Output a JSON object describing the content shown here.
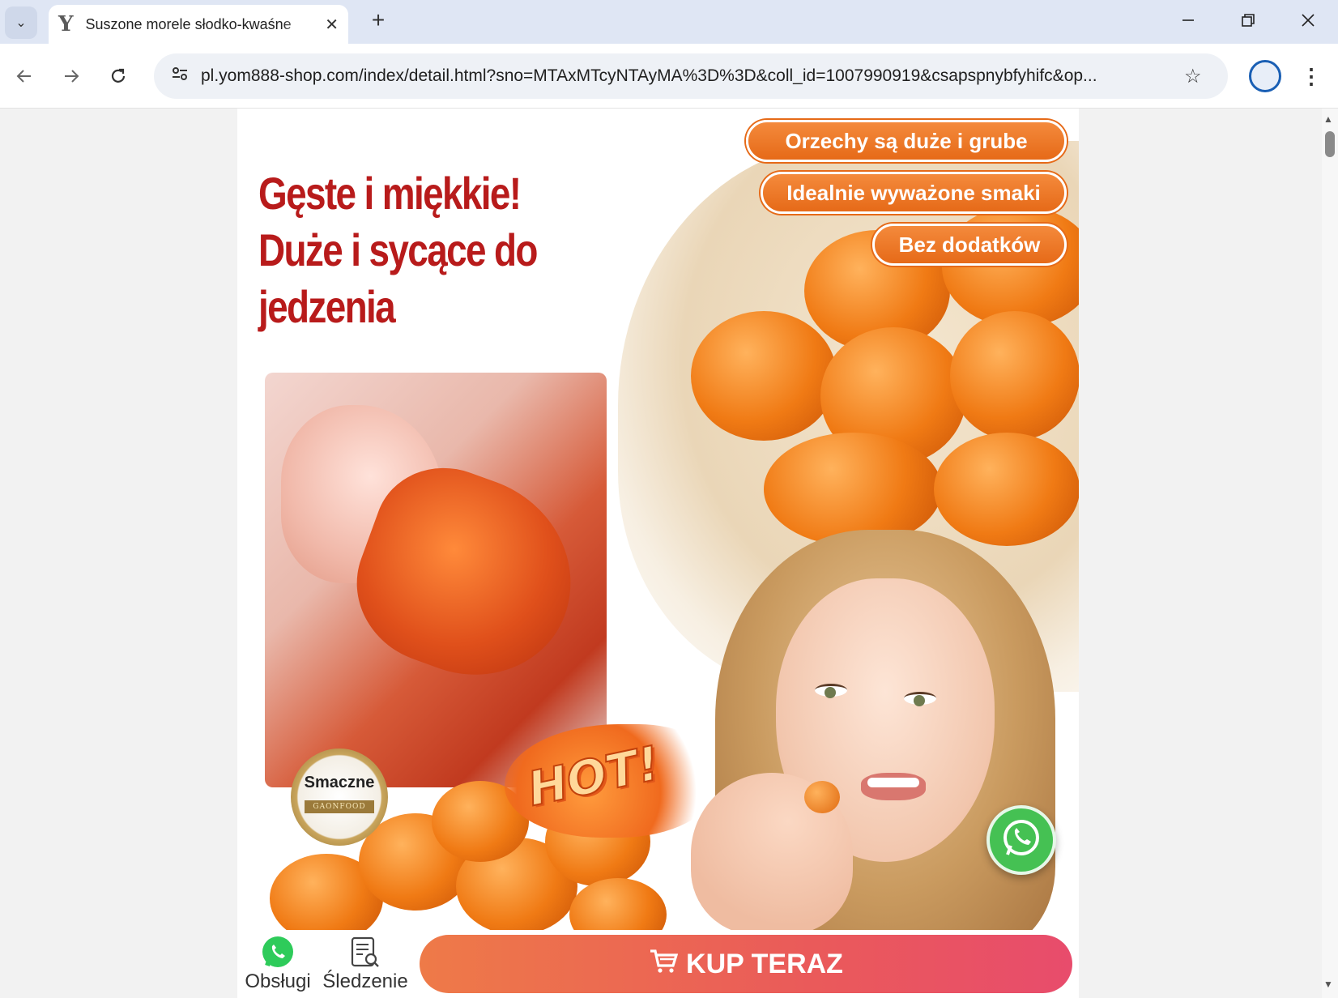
{
  "browser": {
    "tab_title": "Suszone morele słodko-kwaśne",
    "tab_close": "✕",
    "new_tab": "+",
    "url": "pl.yom888-shop.com/index/detail.html?sno=MTAxMTcyNTAyMA%3D%3D&coll_id=1007990919&csapspnybfyhifc&op..."
  },
  "page": {
    "headline": [
      "Gęste i miękkie!",
      "Duże i sycące do",
      "jedzenia"
    ],
    "pills": [
      "Orzechy są duże i grube",
      "Idealnie wyważone smaki",
      "Bez dodatków"
    ],
    "badge": {
      "main": "Smaczne",
      "ribbon": "GAONFOOD"
    },
    "hot_label": "HOT!"
  },
  "bottom_bar": {
    "support_label": "Obsługi",
    "tracking_label": "Śledzenie",
    "buy_label": "KUP TERAZ"
  },
  "colors": {
    "headline": "#b81b1b",
    "pill": "#e66a18",
    "buy_start": "#ee7a48",
    "buy_end": "#e84c6c",
    "whatsapp": "#45c153"
  }
}
